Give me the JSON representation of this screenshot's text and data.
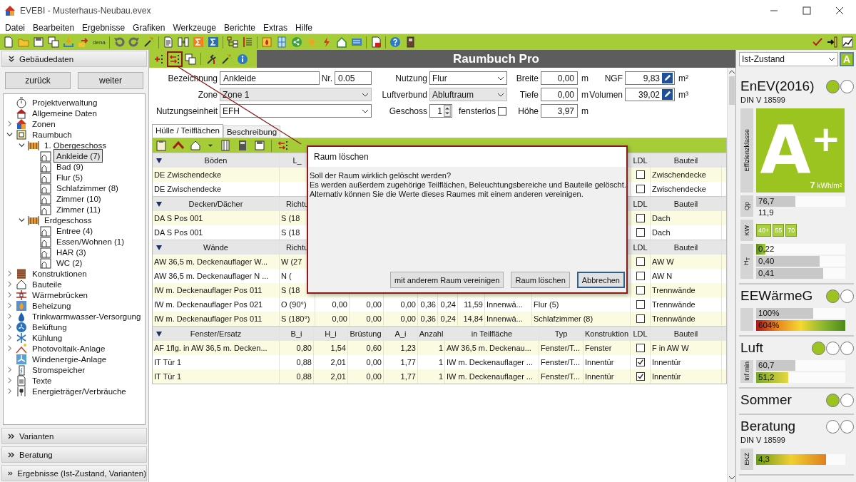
{
  "window": {
    "title": "EVEBI - Musterhaus-Neubau.evex"
  },
  "menu": [
    "Datei",
    "Bearbeiten",
    "Ergebnisse",
    "Grafiken",
    "Werkzeuge",
    "Berichte",
    "Extras",
    "Hilfe"
  ],
  "toolbar": {
    "label": "dena"
  },
  "left_panel": {
    "header": "Gebäudedaten",
    "back": "zurück",
    "next": "weiter",
    "tree": [
      {
        "label": "Projektverwaltung",
        "selected": false
      },
      {
        "label": "Allgemeine Daten",
        "selected": false
      },
      {
        "label": "Zonen",
        "expanded": false,
        "selected": false
      },
      {
        "label": "Raumbuch",
        "expanded": true,
        "selected": false,
        "children": [
          {
            "label": "1. Obergeschoss",
            "expanded": true,
            "selected": false,
            "children": [
              {
                "label": "Ankleide (7)",
                "selected": true
              },
              {
                "label": "Bad (9)",
                "selected": false
              },
              {
                "label": "Flur (5)",
                "selected": false
              },
              {
                "label": "Schlafzimmer (8)",
                "selected": false
              },
              {
                "label": "Zimmer (10)",
                "selected": false
              },
              {
                "label": "Zimmer (11)",
                "selected": false
              }
            ]
          },
          {
            "label": "Erdgeschoss",
            "expanded": true,
            "selected": false,
            "children": [
              {
                "label": "Entree (4)",
                "selected": false
              },
              {
                "label": "Essen/Wohnen (1)",
                "selected": false
              },
              {
                "label": "HAR (3)",
                "selected": false
              },
              {
                "label": "WC (2)",
                "selected": false
              }
            ]
          }
        ]
      },
      {
        "label": "Konstruktionen",
        "expanded": false,
        "selected": false
      },
      {
        "label": "Bauteile",
        "expanded": false,
        "selected": false
      },
      {
        "label": "Wärmebrücken",
        "expanded": false,
        "selected": false
      },
      {
        "label": "Beheizung",
        "expanded": false,
        "selected": false
      },
      {
        "label": "Trinkwarmwasser-Versorgung",
        "expanded": false,
        "selected": false
      },
      {
        "label": "Belüftung",
        "expanded": false,
        "selected": false
      },
      {
        "label": "Kühlung",
        "expanded": false,
        "selected": false
      },
      {
        "label": "Photovoltaik-Anlage",
        "expanded": false,
        "selected": false
      },
      {
        "label": "Windenergie-Anlage",
        "selected": false
      },
      {
        "label": "Stromspeicher",
        "expanded": false,
        "selected": false
      },
      {
        "label": "Texte",
        "expanded": false,
        "selected": false
      },
      {
        "label": "Energieträger/Verbräuche",
        "expanded": false,
        "selected": false
      }
    ],
    "sections": [
      "Varianten",
      "Beratung",
      "Ergebnisse (Ist-Zustand, Varianten)"
    ]
  },
  "room_editor": {
    "title": "Raumbuch Pro",
    "form": [
      {
        "slots": [
          [
            {
              "kind": "text",
              "label": "Bezeichnung",
              "value": "Ankleide"
            },
            {
              "kind": "text",
              "label": "Nr.",
              "value": "0.05"
            }
          ],
          [
            {
              "kind": "select",
              "label": "Nutzung",
              "value": "Flur",
              "disabled": false
            }
          ],
          [
            {
              "kind": "number",
              "label": "Breite",
              "value": "0,00",
              "unit": "m"
            }
          ],
          [
            {
              "kind": "edit",
              "label": "NGF",
              "value": "9,83",
              "unit": "m²"
            }
          ]
        ]
      },
      {
        "slots": [
          [
            {
              "kind": "select",
              "label": "Zone",
              "value": "Zone 1",
              "disabled": true
            }
          ],
          [
            {
              "kind": "select",
              "label": "Luftverbund",
              "value": "Abluftraum",
              "disabled": true
            }
          ],
          [
            {
              "kind": "number",
              "label": "Tiefe",
              "value": "0,00",
              "unit": "m"
            }
          ],
          [
            {
              "kind": "edit",
              "label": "Volumen",
              "value": "39,02",
              "unit": "m³"
            }
          ]
        ]
      },
      {
        "slots": [
          [
            {
              "kind": "select",
              "label": "Nutzungseinheit",
              "value": "EFH",
              "disabled": false
            }
          ],
          [
            {
              "kind": "spin",
              "label": "Geschoss",
              "value": "1"
            },
            {
              "kind": "check",
              "label": "fensterlos",
              "checked": false
            }
          ],
          [
            {
              "kind": "number",
              "label": "Höhe",
              "value": "3,97",
              "unit": "m"
            }
          ]
        ]
      }
    ],
    "tabs": [
      {
        "label": "Hülle / Teilflächen",
        "selected": true
      },
      {
        "label": "Beschreibung",
        "selected": false
      }
    ],
    "sections": [
      {
        "kind": "surface",
        "header": [
          "Böden",
          "L_"
        ],
        "ldl": "LDL",
        "part": "Bauteil",
        "rows": [
          {
            "cells": [
              "DE Zwischendecke"
            ],
            "ldl": false,
            "part": "Zwischendecke"
          },
          {
            "cells": [
              "DE Zwischendecke"
            ],
            "ldl": false,
            "part": "Zwischendecke"
          }
        ]
      },
      {
        "kind": "surface",
        "header": [
          "Decken/Dächer",
          "Richtu"
        ],
        "ldl": "LDL",
        "part": "Bauteil",
        "rows": [
          {
            "cells": [
              "DA S Pos 001",
              "S (18"
            ],
            "ldl": false,
            "part": "Dach"
          },
          {
            "cells": [
              "DA S Pos 001",
              "S (18"
            ],
            "ldl": false,
            "part": "Dach"
          }
        ]
      },
      {
        "kind": "surface",
        "header": [
          "Wände",
          "Richtu"
        ],
        "ldl": "LDL",
        "part": "Bauteil",
        "rows": [
          {
            "cells": [
              "AW 36,5 m. Deckenauflager W...",
              "W (27"
            ],
            "ldl": false,
            "part": "AW W"
          },
          {
            "cells": [
              "AW 36,5 m. Deckenauflager N ...",
              "N ("
            ],
            "ldl": false,
            "part": "AW N"
          },
          {
            "cells": [
              "IW m. Deckenauflager Pos 011",
              "S (18"
            ],
            "ldl": false,
            "part": "Trennwände"
          },
          {
            "cells": [
              "IW m. Deckenauflager Pos 021",
              "O (90°)",
              "0,00",
              "0,00",
              "0,00",
              "0,36",
              "0,24",
              "11,59",
              "Innenwä...",
              "Flur (5)"
            ],
            "ldl": false,
            "part": "Trennwände"
          },
          {
            "cells": [
              "IW m. Deckenauflager Pos 011",
              "S (180°)",
              "0,00",
              "0,00",
              "0,00",
              "0,36",
              "0,24",
              "14,84",
              "Innenwä...",
              "Schlafzimmer (8)"
            ],
            "ldl": false,
            "part": "Trennwände"
          }
        ]
      },
      {
        "kind": "window",
        "header": [
          "Fenster/Ersatz",
          "B_i",
          "H_i",
          "Brüstung",
          "A_i",
          "Anzahl",
          "in Teilfläche",
          "Typ",
          "Konstruktion"
        ],
        "ldl": "LDL",
        "part": "Bauteil",
        "rows": [
          {
            "cells": [
              "AF 1flg. in AW 36,5 m. Decken...",
              "0,80",
              "1,54",
              "0,60",
              "1,23",
              "1",
              "AW 36,5 m. Deckenau...",
              "Fenster/T...",
              "Fenster"
            ],
            "ldl": false,
            "part": "F in AW W"
          },
          {
            "cells": [
              "IT Tür 1",
              "0,88",
              "2,01",
              "0,00",
              "1,77",
              "1",
              "IW m. Deckenauflager ...",
              "Fenster/T...",
              "Innentür"
            ],
            "ldl": true,
            "part": "Innentür"
          },
          {
            "cells": [
              "IT Tür 1",
              "0,88",
              "2,01",
              "0,00",
              "1,77",
              "1",
              "IW m. Deckenauflager ...",
              "Fenster/T...",
              "Innentür"
            ],
            "ldl": true,
            "part": "Innentür"
          }
        ]
      }
    ]
  },
  "dialog": {
    "title": "Raum löschen",
    "lines": [
      "Soll der Raum wirklich gelöscht werden?",
      "Es werden außerdem zugehörige Teilflächen, Beleuchtungsbereiche und Bauteile gelöscht.",
      "Alternativ können Sie die Werte dieses Raumes mit einem anderen vereinigen."
    ],
    "buttons": [
      {
        "label": "mit anderem Raum vereinigen",
        "default": false
      },
      {
        "label": "Raum löschen",
        "default": false
      },
      {
        "label": "Abbrechen",
        "default": true
      }
    ]
  },
  "right_panel": {
    "variant": "Ist-Zustand",
    "mode_button": "A",
    "blocks": [
      {
        "kind": "enev",
        "title": "EnEV(2016)",
        "subtitle": "DIN V 18599",
        "lights": [
          {
            "on": true
          },
          {
            "on": false
          }
        ],
        "class_label": "Effizienzklasse",
        "rating": "A$^{+}$",
        "value": "**7** kWh/m²",
        "groups": [
          {
            "kind": "bars",
            "label": "Qp",
            "bars": [
              {
                "kind": "grey",
                "text": "76,7",
                "level": 0.44
              },
              {
                "kind": "plain",
                "text": "11,9"
              }
            ]
          },
          {
            "kind": "chips",
            "label": "KW",
            "chips": [
              "40+",
              "55",
              "70"
            ]
          },
          {
            "kind": "bars",
            "label": "H$_{T}$",
            "bars": [
              {
                "kind": "green",
                "text": "0,22",
                "level": 0.1
              },
              {
                "kind": "grey",
                "text": "0,40",
                "level": 0.71
              },
              {
                "kind": "grey",
                "text": "0,41",
                "level": 0.75
              }
            ]
          }
        ]
      },
      {
        "kind": "plain",
        "title": "EEWärmeG",
        "lights": [
          {
            "on": true
          },
          {
            "on": false
          }
        ],
        "groups": [
          {
            "kind": "bars",
            "bars": [
              {
                "kind": "grey",
                "text": "100%",
                "level": 0.64
              },
              {
                "kind": "red-green",
                "text": "604%",
                "level": 1
              }
            ]
          }
        ]
      },
      {
        "kind": "plain",
        "title": "Luft",
        "lights": [
          {
            "on": true
          },
          {
            "on": false
          },
          {
            "on": false
          }
        ],
        "groups": [
          {
            "kind": "bars",
            "label": "Inf min",
            "bars": [
              {
                "kind": "grey",
                "text": "60,7",
                "level": 0.44
              },
              {
                "kind": "green-yellow",
                "text": "51,2",
                "level": 0.36
              }
            ]
          }
        ]
      },
      {
        "kind": "plain",
        "title": "Sommer",
        "lights": [
          {
            "on": true
          },
          {
            "on": false
          }
        ]
      },
      {
        "kind": "plain",
        "title": "Beratung",
        "subtitle": "DIN V 18599",
        "lights": [
          {
            "on": false
          },
          {
            "on": false
          }
        ],
        "groups": [
          {
            "kind": "bars",
            "label": "EKZ",
            "bars": [
              {
                "kind": "green-orange",
                "text": "4,3",
                "level": 0.78
              }
            ]
          }
        ]
      }
    ]
  }
}
